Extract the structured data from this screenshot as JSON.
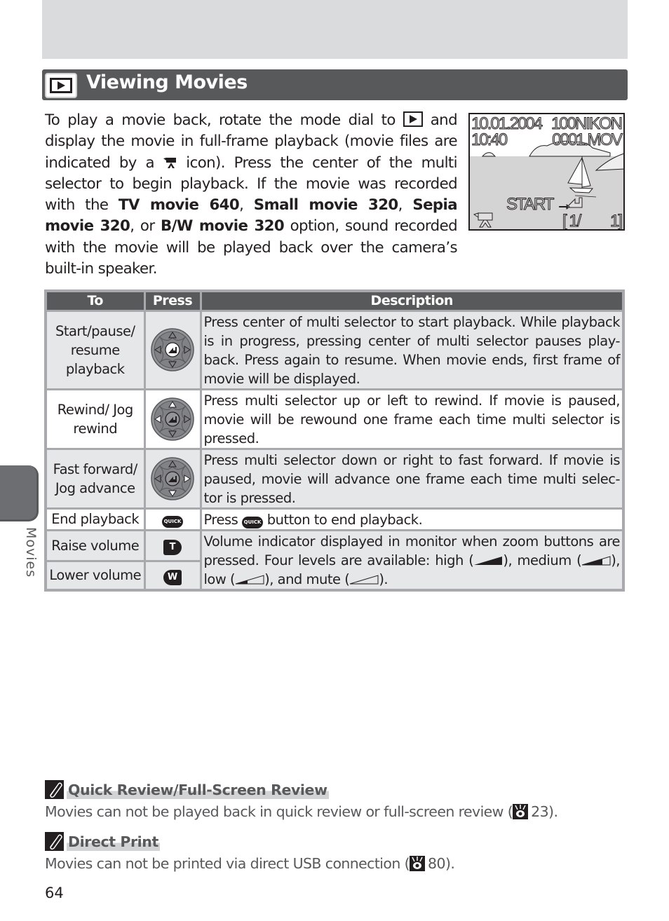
{
  "page": {
    "title": "Viewing Movies",
    "section_tab": "Movies",
    "page_number": "64"
  },
  "intro": {
    "part1": "To play a movie back, rotate the mode dial to",
    "part2": "and display the movie in full-frame playback (movie files are indicated by a",
    "part3": "icon).  Press the center of the multi selector to begin playback.  If the movie was recorded with the",
    "opt1": "TV movie 640",
    "sep1": ",",
    "opt2": "Small movie 320",
    "sep2": ",",
    "opt3": "Sepia movie 320",
    "sep3": ", or",
    "opt4": "B/W movie 320",
    "part4": "option, sound recorded with the movie will be played back over the camera’s built-in speaker."
  },
  "monitor": {
    "date": "10.01.2004",
    "time": "10:40",
    "folder": "100NIKON",
    "file": "0001.MOV",
    "prompt": "START →",
    "counter_left": "[  1/",
    "counter_right": "1]"
  },
  "table": {
    "headers": {
      "to": "To",
      "press": "Press",
      "description": "Description"
    },
    "rows": [
      {
        "to": "Start/pause/ resume playback",
        "press": "multi-selector-center",
        "description": "Press center of multi selector to start playback.  While playback is in progress, pressing center of multi selector pauses play-back.  Press again to resume.  When movie ends, first frame of movie will be displayed."
      },
      {
        "to": "Rewind/ Jog rewind",
        "press": "multi-selector-up-left",
        "description": "Press multi selector up or left to rewind. If movie is paused, movie will be rewound one frame each time multi selector is pressed."
      },
      {
        "to": "Fast forward/ Jog advance",
        "press": "multi-selector-down-right",
        "description": "Press multi selector down or right to fast forward. If movie is paused, movie will advance one frame each time multi selec-tor is pressed."
      },
      {
        "to": "End playback",
        "press": "QUICK",
        "description_pre": "Press",
        "description_post": "button to end playback."
      },
      {
        "to": "Raise volume",
        "press": "T"
      },
      {
        "to": "Lower volume",
        "press": "W"
      }
    ],
    "volume_desc": {
      "a": "Volume indicator displayed in monitor when zoom buttons are pressed.  Four levels are available: high (",
      "b": "), medium (",
      "c": "), low (",
      "d": "), and mute (",
      "e": ")."
    }
  },
  "notes": [
    {
      "title": "Quick Review/Full-Screen Review",
      "body_pre": "Movies can not be played back in quick review or full-screen review (",
      "ref": "23",
      "body_post": ")."
    },
    {
      "title": "Direct Print",
      "body_pre": "Movies can not be printed via direct USB connection (",
      "ref": "80",
      "body_post": ")."
    }
  ]
}
